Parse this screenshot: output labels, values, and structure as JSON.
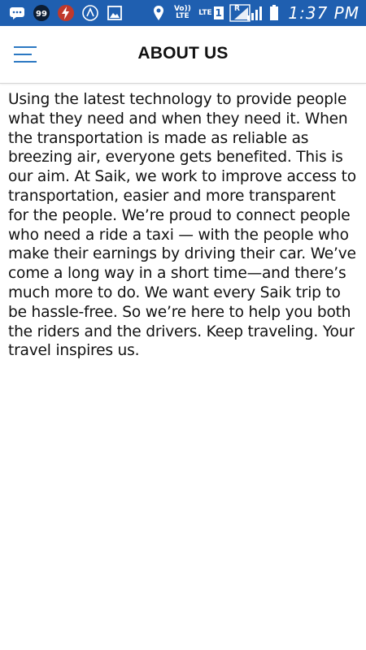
{
  "colors": {
    "status_bar": "#1f5fb0",
    "menu_icon": "#2b78c2",
    "title_text": "#111111",
    "body_text": "#111111"
  },
  "status_bar": {
    "left_icons": [
      "message-icon",
      "notification-99-icon",
      "flash-app-icon",
      "navigation-app-icon",
      "gallery-icon"
    ],
    "notification_badge": "99",
    "right_icons": [
      "location-icon",
      "volte-icon",
      "lte-sim1-icon",
      "roaming-signal-icon",
      "roaming-signal-icon",
      "battery-icon"
    ],
    "volte_label": "Vo)) LTE",
    "lte_label": "LTE",
    "sim1_label": "1",
    "roaming_label": "R",
    "time": "1:37 PM"
  },
  "app_bar": {
    "menu_icon": "hamburger-menu-icon",
    "title": "ABOUT US"
  },
  "about": {
    "body": "Using the latest technology to provide people what they need and when they need it. When the transportation is made as reliable as breezing air, everyone gets benefited. This is our aim. At Saik, we work to improve access to transportation, easier and more transparent for the people. We’re proud to connect people who need a ride a taxi — with the people who make their earnings by driving their car. We’ve come a long way in a short time—and there’s much more to do. We want every Saik trip to be hassle-free. So we’re here to help you both the riders and the drivers. Keep traveling. Your travel inspires us."
  }
}
